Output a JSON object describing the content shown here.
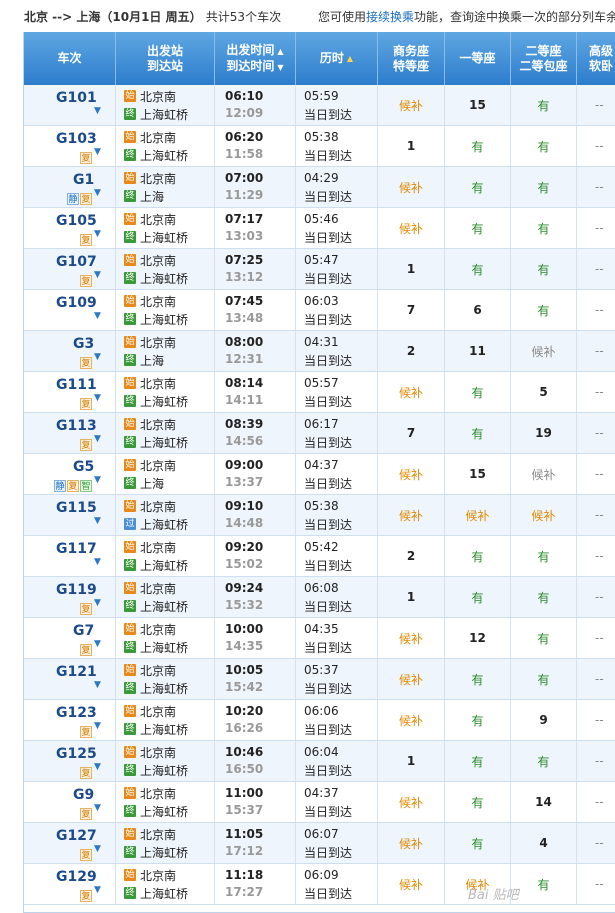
{
  "topbar": {
    "route": "北京 --> 上海（10月1日  周五）",
    "count": "共计53个车次",
    "tip_pre": "您可使用",
    "tip_link": "接续换乘",
    "tip_post": "功能，查询途中换乘一次的部分列车余"
  },
  "headers": {
    "train": "车次",
    "station_1": "出发站",
    "station_2": "到达站",
    "time_1": "出发时间",
    "time_2": "到达时间",
    "duration": "历时",
    "biz_1": "商务座",
    "biz_2": "特等座",
    "first": "一等座",
    "second_1": "二等座",
    "second_2": "二等包座",
    "high_1": "高级",
    "high_2": "软卧"
  },
  "icons": {
    "start": "始",
    "end": "终",
    "pass": "过",
    "sort_asc": "▲",
    "sort_desc": "▼",
    "expand": "▼"
  },
  "rows": [
    {
      "train": "G101",
      "tags": [],
      "from": "北京南",
      "from_type": "始",
      "to": "上海虹桥",
      "to_type": "终",
      "dep": "06:10",
      "arr": "12:09",
      "dur": "05:59",
      "arrive_day": "当日到达",
      "biz": "候补",
      "first": "15",
      "second": "有",
      "high": "--"
    },
    {
      "train": "G103",
      "tags": [
        "复"
      ],
      "from": "北京南",
      "from_type": "始",
      "to": "上海虹桥",
      "to_type": "终",
      "dep": "06:20",
      "arr": "11:58",
      "dur": "05:38",
      "arrive_day": "当日到达",
      "biz": "1",
      "first": "有",
      "second": "有",
      "high": "--"
    },
    {
      "train": "G1",
      "tags": [
        "静",
        "复"
      ],
      "from": "北京南",
      "from_type": "始",
      "to": "上海",
      "to_type": "终",
      "dep": "07:00",
      "arr": "11:29",
      "dur": "04:29",
      "arrive_day": "当日到达",
      "biz": "候补",
      "first": "有",
      "second": "有",
      "high": "--"
    },
    {
      "train": "G105",
      "tags": [
        "复"
      ],
      "from": "北京南",
      "from_type": "始",
      "to": "上海虹桥",
      "to_type": "终",
      "dep": "07:17",
      "arr": "13:03",
      "dur": "05:46",
      "arrive_day": "当日到达",
      "biz": "候补",
      "first": "有",
      "second": "有",
      "high": "--"
    },
    {
      "train": "G107",
      "tags": [
        "复"
      ],
      "from": "北京南",
      "from_type": "始",
      "to": "上海虹桥",
      "to_type": "终",
      "dep": "07:25",
      "arr": "13:12",
      "dur": "05:47",
      "arrive_day": "当日到达",
      "biz": "1",
      "first": "有",
      "second": "有",
      "high": "--"
    },
    {
      "train": "G109",
      "tags": [],
      "from": "北京南",
      "from_type": "始",
      "to": "上海虹桥",
      "to_type": "终",
      "dep": "07:45",
      "arr": "13:48",
      "dur": "06:03",
      "arrive_day": "当日到达",
      "biz": "7",
      "first": "6",
      "second": "有",
      "high": "--"
    },
    {
      "train": "G3",
      "tags": [
        "复"
      ],
      "from": "北京南",
      "from_type": "始",
      "to": "上海",
      "to_type": "终",
      "dep": "08:00",
      "arr": "12:31",
      "dur": "04:31",
      "arrive_day": "当日到达",
      "biz": "2",
      "first": "11",
      "second": "候补",
      "high": "--"
    },
    {
      "train": "G111",
      "tags": [
        "复"
      ],
      "from": "北京南",
      "from_type": "始",
      "to": "上海虹桥",
      "to_type": "终",
      "dep": "08:14",
      "arr": "14:11",
      "dur": "05:57",
      "arrive_day": "当日到达",
      "biz": "候补",
      "first": "有",
      "second": "5",
      "high": "--"
    },
    {
      "train": "G113",
      "tags": [
        "复"
      ],
      "from": "北京南",
      "from_type": "始",
      "to": "上海虹桥",
      "to_type": "终",
      "dep": "08:39",
      "arr": "14:56",
      "dur": "06:17",
      "arrive_day": "当日到达",
      "biz": "7",
      "first": "有",
      "second": "19",
      "high": "--"
    },
    {
      "train": "G5",
      "tags": [
        "静",
        "复",
        "智"
      ],
      "from": "北京南",
      "from_type": "始",
      "to": "上海",
      "to_type": "终",
      "dep": "09:00",
      "arr": "13:37",
      "dur": "04:37",
      "arrive_day": "当日到达",
      "biz": "候补",
      "first": "15",
      "second": "候补",
      "high": "--"
    },
    {
      "train": "G115",
      "tags": [],
      "from": "北京南",
      "from_type": "始",
      "to": "上海虹桥",
      "to_type": "过",
      "dep": "09:10",
      "arr": "14:48",
      "dur": "05:38",
      "arrive_day": "当日到达",
      "biz": "候补",
      "first": "候补",
      "second": "候补",
      "high": "--"
    },
    {
      "train": "G117",
      "tags": [],
      "from": "北京南",
      "from_type": "始",
      "to": "上海虹桥",
      "to_type": "终",
      "dep": "09:20",
      "arr": "15:02",
      "dur": "05:42",
      "arrive_day": "当日到达",
      "biz": "2",
      "first": "有",
      "second": "有",
      "high": "--"
    },
    {
      "train": "G119",
      "tags": [
        "复"
      ],
      "from": "北京南",
      "from_type": "始",
      "to": "上海虹桥",
      "to_type": "终",
      "dep": "09:24",
      "arr": "15:32",
      "dur": "06:08",
      "arrive_day": "当日到达",
      "biz": "1",
      "first": "有",
      "second": "有",
      "high": "--"
    },
    {
      "train": "G7",
      "tags": [
        "复"
      ],
      "from": "北京南",
      "from_type": "始",
      "to": "上海虹桥",
      "to_type": "终",
      "dep": "10:00",
      "arr": "14:35",
      "dur": "04:35",
      "arrive_day": "当日到达",
      "biz": "候补",
      "first": "12",
      "second": "有",
      "high": "--"
    },
    {
      "train": "G121",
      "tags": [],
      "from": "北京南",
      "from_type": "始",
      "to": "上海虹桥",
      "to_type": "终",
      "dep": "10:05",
      "arr": "15:42",
      "dur": "05:37",
      "arrive_day": "当日到达",
      "biz": "候补",
      "first": "有",
      "second": "有",
      "high": "--"
    },
    {
      "train": "G123",
      "tags": [
        "复"
      ],
      "from": "北京南",
      "from_type": "始",
      "to": "上海虹桥",
      "to_type": "终",
      "dep": "10:20",
      "arr": "16:26",
      "dur": "06:06",
      "arrive_day": "当日到达",
      "biz": "候补",
      "first": "有",
      "second": "9",
      "high": "--"
    },
    {
      "train": "G125",
      "tags": [
        "复"
      ],
      "from": "北京南",
      "from_type": "始",
      "to": "上海虹桥",
      "to_type": "终",
      "dep": "10:46",
      "arr": "16:50",
      "dur": "06:04",
      "arrive_day": "当日到达",
      "biz": "1",
      "first": "有",
      "second": "有",
      "high": "--"
    },
    {
      "train": "G9",
      "tags": [
        "复"
      ],
      "from": "北京南",
      "from_type": "始",
      "to": "上海虹桥",
      "to_type": "终",
      "dep": "11:00",
      "arr": "15:37",
      "dur": "04:37",
      "arrive_day": "当日到达",
      "biz": "候补",
      "first": "有",
      "second": "14",
      "high": "--"
    },
    {
      "train": "G127",
      "tags": [
        "复"
      ],
      "from": "北京南",
      "from_type": "始",
      "to": "上海虹桥",
      "to_type": "终",
      "dep": "11:05",
      "arr": "17:12",
      "dur": "06:07",
      "arrive_day": "当日到达",
      "biz": "候补",
      "first": "有",
      "second": "4",
      "high": "--"
    },
    {
      "train": "G129",
      "tags": [
        "复"
      ],
      "from": "北京南",
      "from_type": "始",
      "to": "上海虹桥",
      "to_type": "终",
      "dep": "11:18",
      "arr": "17:27",
      "dur": "06:09",
      "arrive_day": "当日到达",
      "biz": "候补",
      "first": "候补",
      "second": "有",
      "high": "--"
    }
  ],
  "watermark": "Bai 贴吧",
  "colors": {
    "header": "#2d7dcd",
    "alt_row": "#eef5fc",
    "have": "#2a8c2a",
    "waitlist": "#e08a00",
    "train_no": "#1c4a8a",
    "link": "#1a6ec2"
  }
}
